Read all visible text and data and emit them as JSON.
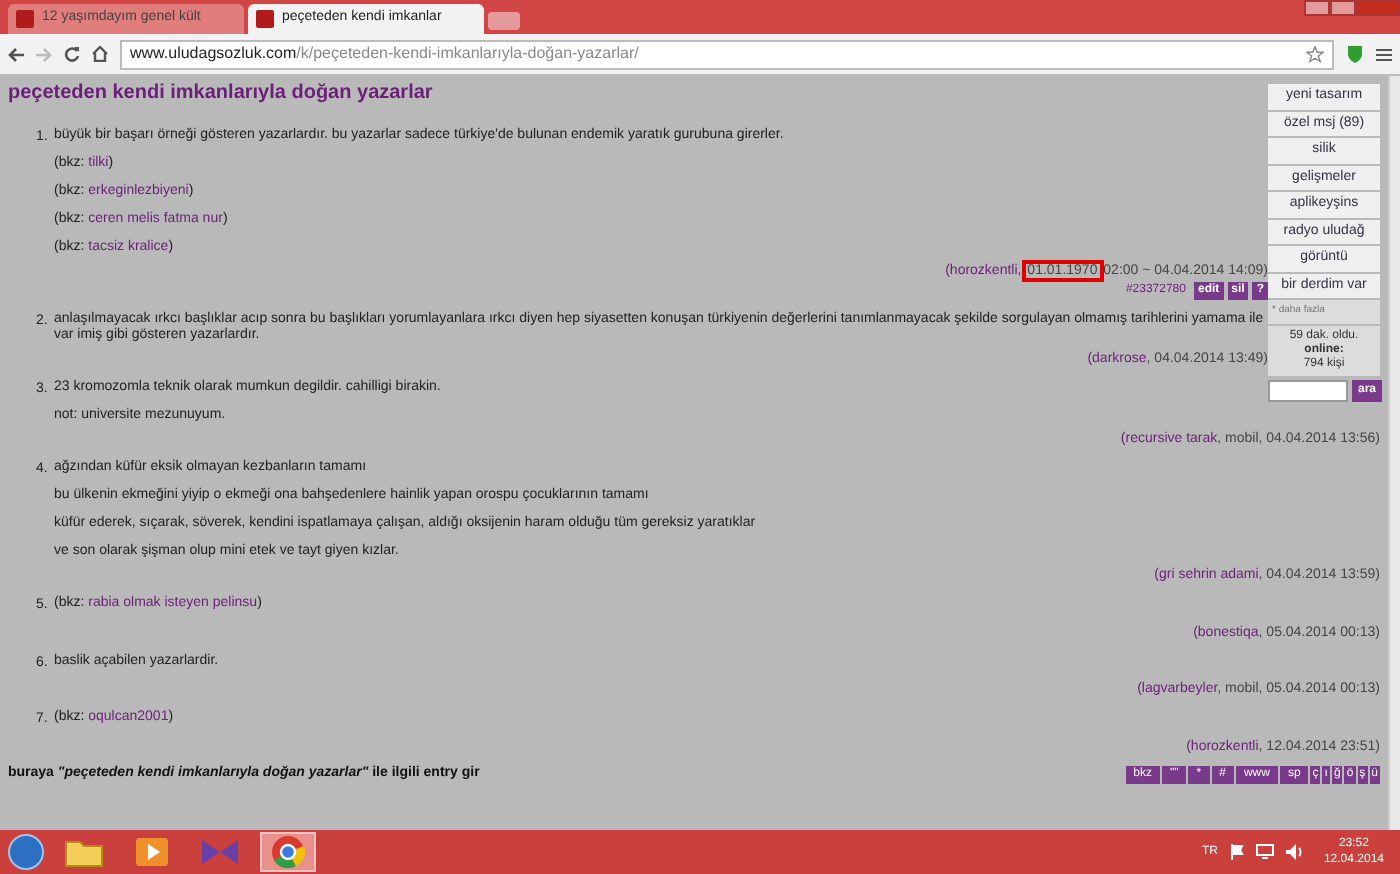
{
  "browser": {
    "tabs": [
      {
        "title": "12 yaşımdayım genel kült",
        "selected": false
      },
      {
        "title": "peçeteden kendi imkanlar",
        "selected": true
      }
    ],
    "address": {
      "host": "www.uludagsozluk.com",
      "path": "/k/peçeteden-kendi-imkanlarıyla-doğan-yazarlar/"
    }
  },
  "page": {
    "title": "peçeteden kendi imkanlarıyla doğan yazarlar",
    "menu": [
      {
        "label": "yeni tasarım"
      },
      {
        "label": "özel msj (89)"
      },
      {
        "label": "silik"
      },
      {
        "label": "gelişmeler"
      },
      {
        "label": "aplikeyşins"
      },
      {
        "label": "radyo uludağ"
      },
      {
        "label": "görüntü"
      },
      {
        "label": "bir derdim var"
      }
    ],
    "more": "* daha fazla",
    "status": "59 dak. oldu.",
    "online_label": "online:",
    "online_count": "794 kişi",
    "search_button": "ara",
    "entries": [
      {
        "number": "1.",
        "lines": [
          [
            {
              "kind": "plain",
              "text": "büyük bir başarı örneği gösteren yazarlardır. bu yazarlar sadece türkiye'de bulunan endemik yaratık gurubuna girerler."
            }
          ],
          [
            {
              "kind": "plain",
              "text": "(bkz: "
            },
            {
              "kind": "link",
              "text": "tilki"
            },
            {
              "kind": "plain",
              "text": ")"
            }
          ],
          [
            {
              "kind": "plain",
              "text": "(bkz: "
            },
            {
              "kind": "link",
              "text": "erkeginlezbiyeni"
            },
            {
              "kind": "plain",
              "text": ")"
            }
          ],
          [
            {
              "kind": "plain",
              "text": "(bkz: "
            },
            {
              "kind": "link",
              "text": "ceren melis fatma nur"
            },
            {
              "kind": "plain",
              "text": ")"
            }
          ],
          [
            {
              "kind": "plain",
              "text": "(bkz: "
            },
            {
              "kind": "link",
              "text": "tacsiz kralice"
            },
            {
              "kind": "plain",
              "text": ")"
            }
          ]
        ],
        "footer": [
          {
            "kind": "link",
            "text": "(horozkentli"
          },
          {
            "kind": "plain",
            "text": ", "
          },
          {
            "kind": "marked",
            "text": "01.01.1970"
          },
          {
            "kind": "plain",
            "text": " 02:00 ~ 04.04.2014 14:09)"
          }
        ],
        "entry_id": "#23372780",
        "actions": [
          "edit",
          "sil",
          "?"
        ]
      },
      {
        "number": "2.",
        "lines": [
          [
            {
              "kind": "plain",
              "text": "anlaşılmayacak ırkcı başlıklar acıp sonra bu başlıkları yorumlayanlara ırkcı diyen hep siyasetten konuşan türkiyenin değerlerini tanımlanmayacak şekilde sorgulayan olmamış tarihlerini yamama ile var imiş gibi gösteren yazarlardır."
            }
          ]
        ],
        "footer": [
          {
            "kind": "link",
            "text": "(darkrose"
          },
          {
            "kind": "plain",
            "text": ", 04.04.2014 13:49)"
          }
        ]
      },
      {
        "number": "3.",
        "lines": [
          [
            {
              "kind": "plain",
              "text": "23 kromozomla teknik olarak mumkun degildir. cahilligi birakin."
            }
          ],
          [
            {
              "kind": "plain",
              "text": "not: universite mezunuyum."
            }
          ]
        ],
        "footer": [
          {
            "kind": "link",
            "text": "(recursive tarak"
          },
          {
            "kind": "plain",
            "text": ", mobil, 04.04.2014 13:56)"
          }
        ]
      },
      {
        "number": "4.",
        "lines": [
          [
            {
              "kind": "plain",
              "text": "ağzından küfür eksik olmayan kezbanların tamamı"
            }
          ],
          [
            {
              "kind": "plain",
              "text": "bu ülkenin ekmeğini yiyip o ekmeği ona bahşedenlere hainlik yapan orospu çocuklarının tamamı"
            }
          ],
          [
            {
              "kind": "plain",
              "text": "küfür ederek, sıçarak, söverek, kendini ispatlamaya çalışan, aldığı oksijenin haram olduğu tüm gereksiz yaratıklar"
            }
          ],
          [
            {
              "kind": "plain",
              "text": "ve son olarak şişman olup mini etek ve tayt giyen kızlar."
            }
          ]
        ],
        "footer": [
          {
            "kind": "link",
            "text": "(gri sehrin adami"
          },
          {
            "kind": "plain",
            "text": ", 04.04.2014 13:59)"
          }
        ]
      },
      {
        "number": "5.",
        "lines": [
          [
            {
              "kind": "plain",
              "text": "(bkz: "
            },
            {
              "kind": "link",
              "text": "rabia olmak isteyen pelinsu"
            },
            {
              "kind": "plain",
              "text": ")"
            }
          ]
        ],
        "footer": [
          {
            "kind": "link",
            "text": "(bonestiqa"
          },
          {
            "kind": "plain",
            "text": ", 05.04.2014 00:13)"
          }
        ]
      },
      {
        "number": "6.",
        "lines": [
          [
            {
              "kind": "plain",
              "text": "baslik açabilen yazarlardir."
            }
          ]
        ],
        "footer": [
          {
            "kind": "link",
            "text": "(lagvarbeyler"
          },
          {
            "kind": "plain",
            "text": ", mobil, 05.04.2014 00:13)"
          }
        ]
      },
      {
        "number": "7.",
        "lines": [
          [
            {
              "kind": "plain",
              "text": "(bkz: "
            },
            {
              "kind": "link",
              "text": "oqulcan2001"
            },
            {
              "kind": "plain",
              "text": ")"
            }
          ]
        ],
        "footer": [
          {
            "kind": "link",
            "text": "(horozkentli"
          },
          {
            "kind": "plain",
            "text": ", 12.04.2014 23:51)"
          }
        ]
      }
    ],
    "compose": "buraya *\"peçeteden kendi imkanlarıyla doğan yazarlar\"* ile ilgili entry gir",
    "tools": [
      "bkz",
      "\"\"",
      "*",
      "#",
      "www",
      "sp"
    ],
    "letters": [
      "ç",
      "ı",
      "ğ",
      "ö",
      "ş",
      "ü"
    ]
  },
  "taskbar": {
    "apps": [
      {
        "kind": "folder",
        "active": false
      },
      {
        "kind": "media",
        "active": false
      },
      {
        "kind": "studio",
        "active": false
      },
      {
        "kind": "chrome",
        "active": true
      }
    ],
    "language": "TR",
    "time": "23:52",
    "date": "12.04.2014"
  }
}
